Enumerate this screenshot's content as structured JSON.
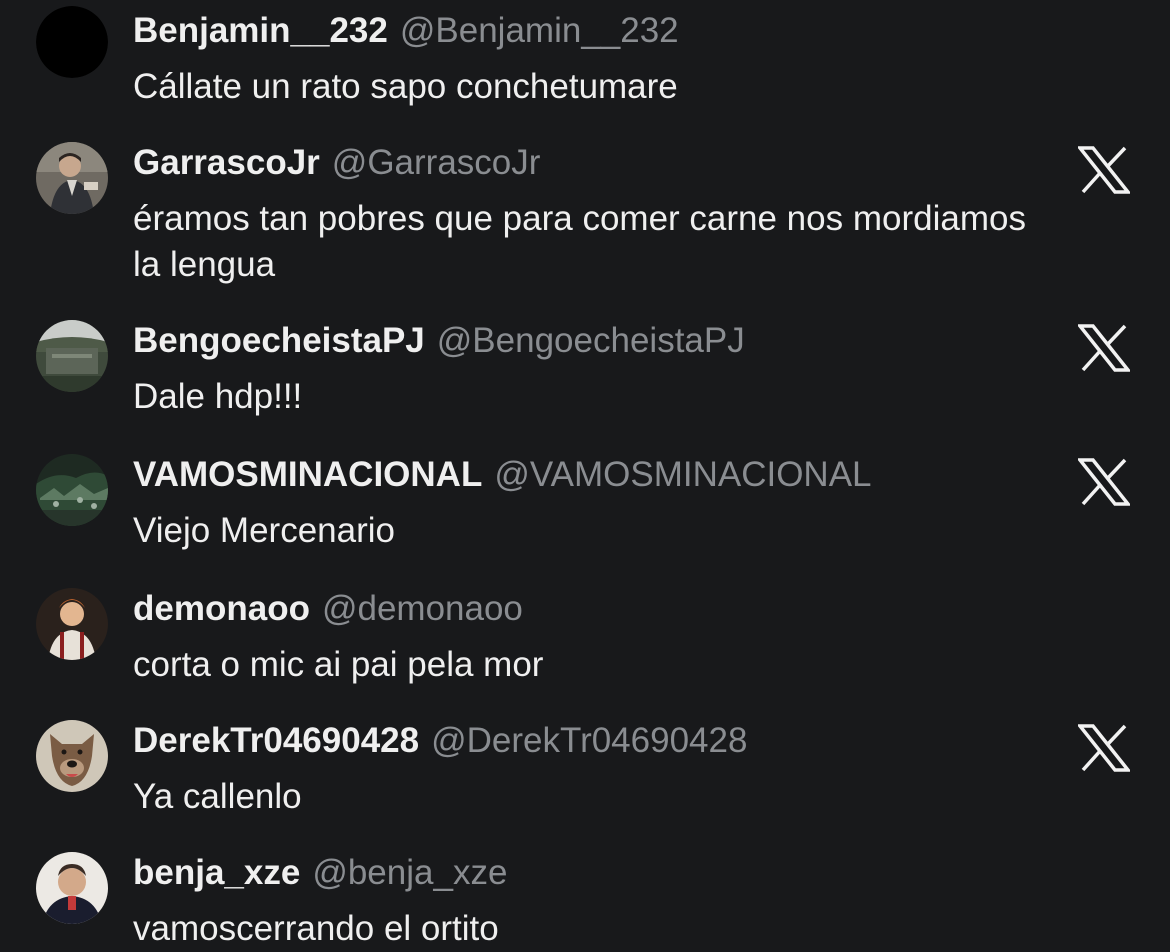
{
  "colors": {
    "background": "#18191b",
    "text": "#efefef",
    "handle": "#8a8d91",
    "x_logo": "#f2f2f2"
  },
  "replies": [
    {
      "display_name": "Benjamin__232",
      "handle": "@Benjamin__232",
      "text": "Cállate un rato sapo conchetumare",
      "avatar_icon": "black-avatar",
      "x_logo": false
    },
    {
      "display_name": "GarrascoJr",
      "handle": "@GarrascoJr",
      "text": "éramos tan pobres que para comer carne nos mordiamos la lengua",
      "avatar_icon": "man-in-suit-avatar",
      "x_logo": true
    },
    {
      "display_name": "BengoecheistaPJ",
      "handle": "@BengoecheistaPJ",
      "text": "Dale hdp!!!",
      "avatar_icon": "stadium-avatar",
      "x_logo": true
    },
    {
      "display_name": "VAMOSMINACIONAL",
      "handle": "@VAMOSMINACIONAL",
      "text": "Viejo Mercenario",
      "avatar_icon": "crowd-avatar",
      "x_logo": true
    },
    {
      "display_name": "demonaoo",
      "handle": "@demonaoo",
      "text": "corta o mic ai pai pela mor",
      "avatar_icon": "cartoon-man-avatar",
      "x_logo": false
    },
    {
      "display_name": "DerekTr04690428",
      "handle": "@DerekTr04690428",
      "text": "Ya callenlo",
      "avatar_icon": "dog-avatar",
      "x_logo": true
    },
    {
      "display_name": "benja_xze",
      "handle": "@benja_xze",
      "text": "vamoscerrando el ortito",
      "avatar_icon": "man-portrait-avatar",
      "x_logo": false
    }
  ]
}
